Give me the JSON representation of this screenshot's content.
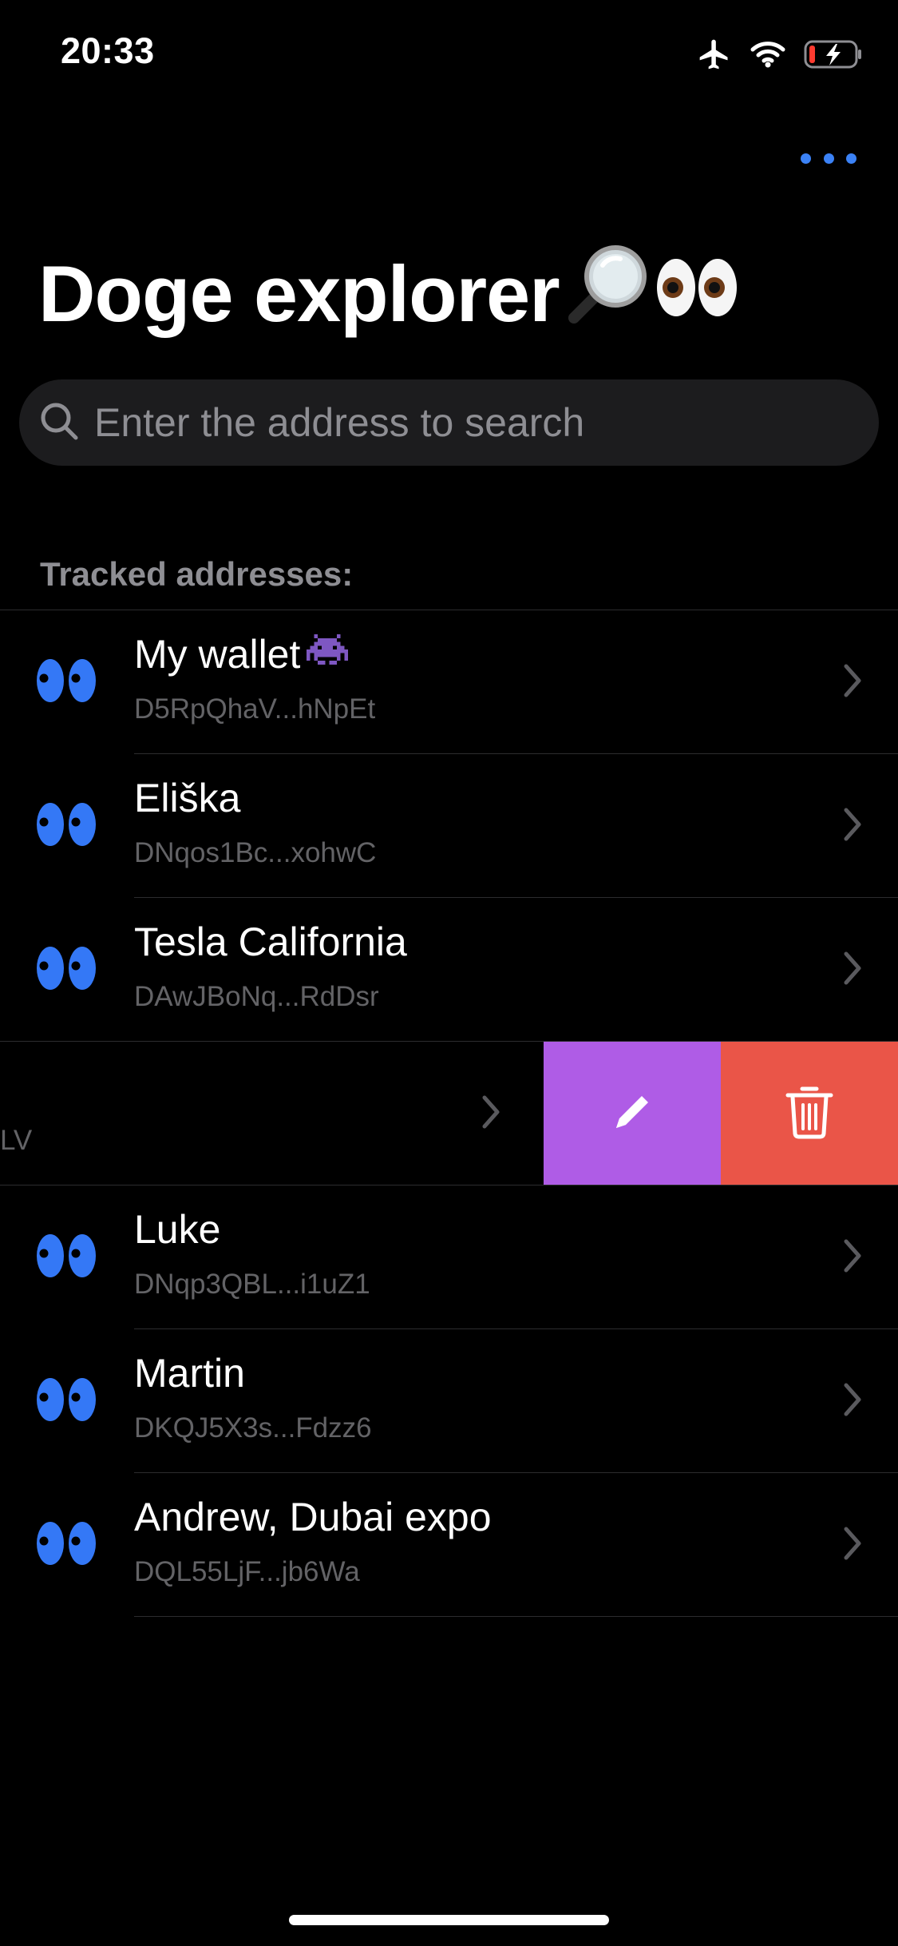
{
  "status_bar": {
    "time": "20:33",
    "icons": [
      "airplane-icon",
      "wifi-icon",
      "battery-charging-icon"
    ],
    "battery_level": 0.15
  },
  "header": {
    "more_icon": "ellipsis-icon",
    "title": "Doge explorer",
    "title_emojis": [
      "magnifier-icon",
      "eyes-icon"
    ]
  },
  "search": {
    "placeholder": "Enter the address to search",
    "value": "",
    "icon": "search-icon"
  },
  "tracked": {
    "header": "Tracked addresses:",
    "items": [
      {
        "name": "My wallet",
        "badge_icon": "alien-monster-icon",
        "address": "D5RpQhaV...hNpEt"
      },
      {
        "name": "Eliška",
        "address": "DNqos1Bc...xohwC"
      },
      {
        "name": "Tesla California",
        "address": "DAwJBoNq...RdDsr"
      },
      {
        "address_tail": "LV",
        "swiped": true,
        "actions": [
          "edit-pencil-icon",
          "trash-icon"
        ]
      },
      {
        "name": "Luke",
        "address": "DNqp3QBL...i1uZ1"
      },
      {
        "name": "Martin",
        "address": "DKQJ5X3s...Fdzz6"
      },
      {
        "name": "Andrew, Dubai expo",
        "address": "DQL55LjF...jb6Wa"
      }
    ]
  },
  "colors": {
    "background": "#000000",
    "accent": "#3b82f6",
    "edit_action": "#af5ce6",
    "delete_action": "#ea5548",
    "secondary_text": "#636366",
    "search_bg": "#1c1c1e"
  }
}
